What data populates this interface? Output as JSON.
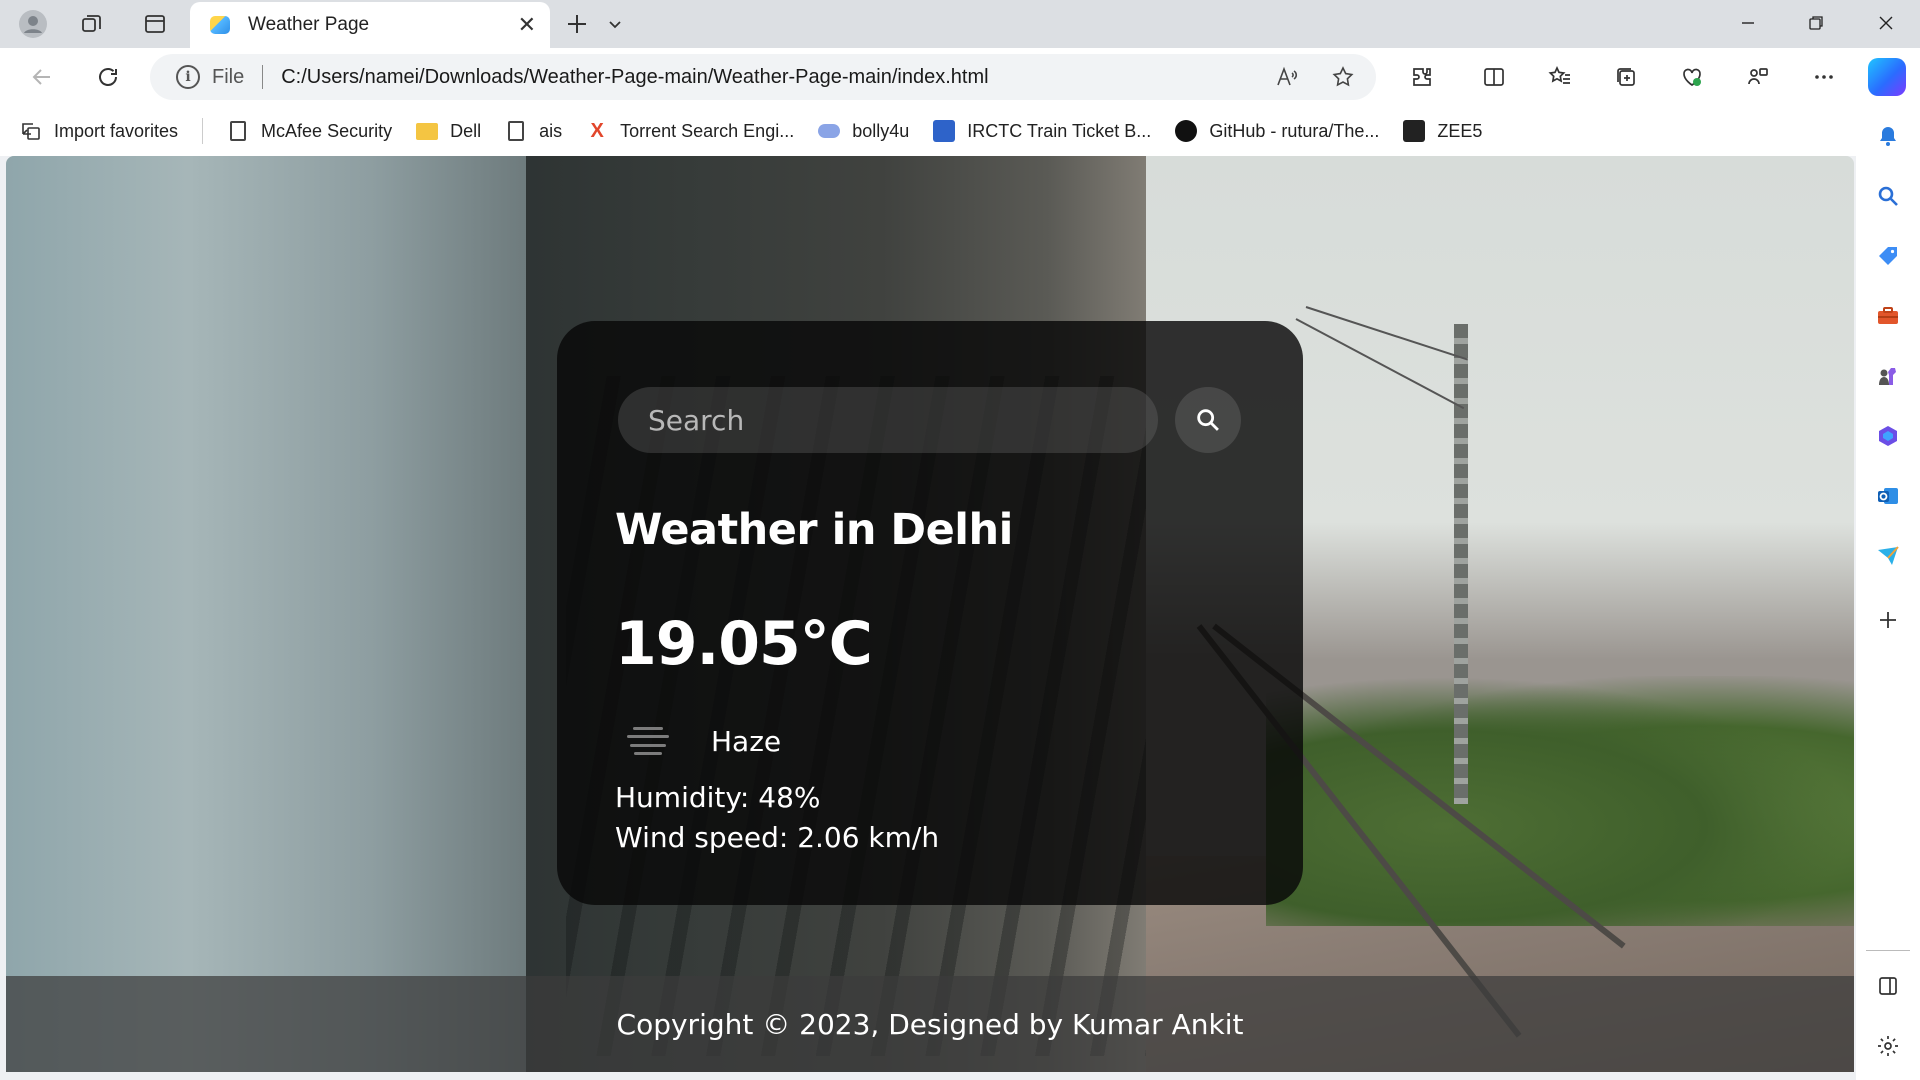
{
  "browser": {
    "tab": {
      "title": "Weather Page"
    },
    "address": {
      "protocol": "File",
      "url": "C:/Users/namei/Downloads/Weather-Page-main/Weather-Page-main/index.html"
    },
    "favorites": [
      {
        "label": "Import favorites",
        "icon": "import-favorites-icon"
      },
      {
        "label": "McAfee Security",
        "icon": "page-icon"
      },
      {
        "label": "Dell",
        "icon": "folder-icon"
      },
      {
        "label": "ais",
        "icon": "page-icon"
      },
      {
        "label": "Torrent Search Engi...",
        "icon": "torrent-icon"
      },
      {
        "label": "bolly4u",
        "icon": "bolly4u-icon"
      },
      {
        "label": "IRCTC Train Ticket B...",
        "icon": "irctc-icon"
      },
      {
        "label": "GitHub - rutura/The...",
        "icon": "github-icon"
      },
      {
        "label": "ZEE5",
        "icon": "zee5-icon"
      }
    ]
  },
  "page": {
    "search": {
      "placeholder": "Search",
      "value": ""
    },
    "weather": {
      "title": "Weather in Delhi",
      "temperature": "19.05°C",
      "condition": "Haze",
      "condition_icon": "haze-icon",
      "humidity": "Humidity: 48%",
      "wind": "Wind speed: 2.06 km/h"
    },
    "footer": {
      "text": "Copyright © 2023, Designed by Kumar Ankit"
    }
  }
}
